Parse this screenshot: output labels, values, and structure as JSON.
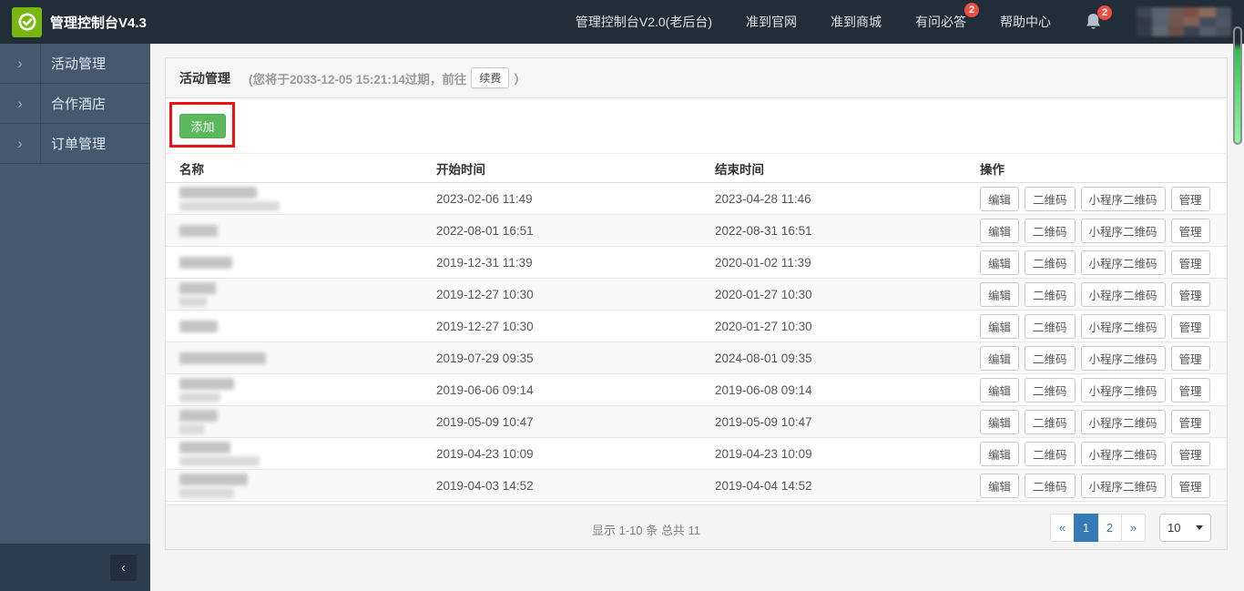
{
  "topbar": {
    "app_title": "管理控制台V4.3",
    "nav": [
      {
        "label": "管理控制台V2.0(老后台)",
        "badge": ""
      },
      {
        "label": "准到官网",
        "badge": ""
      },
      {
        "label": "准到商城",
        "badge": ""
      },
      {
        "label": "有问必答",
        "badge": "2"
      },
      {
        "label": "帮助中心",
        "badge": ""
      }
    ],
    "bell_badge": "2"
  },
  "sidebar": {
    "chevron_glyph": "›",
    "collapse_glyph": "‹",
    "items": [
      {
        "label": "活动管理"
      },
      {
        "label": "合作酒店"
      },
      {
        "label": "订单管理"
      }
    ]
  },
  "page": {
    "title": "活动管理",
    "expiry_before": "(您将于2033-12-05 15:21:14过期，前往",
    "renew_label": "续费",
    "expiry_after": "）"
  },
  "toolbar": {
    "add_label": "添加"
  },
  "table": {
    "columns": [
      "名称",
      "开始时间",
      "结束时间",
      "操作"
    ],
    "action_labels": [
      "编辑",
      "二维码",
      "小程序二维码",
      "管理"
    ],
    "rows": [
      {
        "name_redacted": true,
        "blur_w": 85,
        "blur_w2": 110,
        "start": "2023-02-06 11:49",
        "end": "2023-04-28 11:46"
      },
      {
        "name_redacted": true,
        "blur_w": 42,
        "blur_w2": 0,
        "start": "2022-08-01 16:51",
        "end": "2022-08-31 16:51"
      },
      {
        "name_redacted": true,
        "blur_w": 58,
        "blur_w2": 0,
        "start": "2019-12-31 11:39",
        "end": "2020-01-02 11:39"
      },
      {
        "name_redacted": true,
        "blur_w": 40,
        "blur_w2": 30,
        "start": "2019-12-27 10:30",
        "end": "2020-01-27 10:30"
      },
      {
        "name_redacted": true,
        "blur_w": 42,
        "blur_w2": 0,
        "start": "2019-12-27 10:30",
        "end": "2020-01-27 10:30"
      },
      {
        "name_redacted": true,
        "blur_w": 95,
        "blur_w2": 0,
        "start": "2019-07-29 09:35",
        "end": "2024-08-01 09:35"
      },
      {
        "name_redacted": true,
        "blur_w": 60,
        "blur_w2": 45,
        "start": "2019-06-06 09:14",
        "end": "2019-06-08 09:14"
      },
      {
        "name_redacted": true,
        "blur_w": 42,
        "blur_w2": 28,
        "start": "2019-05-09 10:47",
        "end": "2019-05-09 10:47"
      },
      {
        "name_redacted": true,
        "blur_w": 56,
        "blur_w2": 88,
        "start": "2019-04-23 10:09",
        "end": "2019-04-23 10:09"
      },
      {
        "name_redacted": true,
        "blur_w": 75,
        "blur_w2": 60,
        "start": "2019-04-03 14:52",
        "end": "2019-04-04 14:52"
      }
    ]
  },
  "pagination": {
    "info": "显示 1-10 条 总共 11",
    "prev": "«",
    "pages": [
      "1",
      "2"
    ],
    "active_page": "1",
    "next": "»",
    "page_size": "10"
  },
  "colors": {
    "topbar_bg": "#222d3a",
    "sidebar_bg": "#45586e",
    "brand_green": "#78b80e",
    "button_green": "#5cb85c",
    "active_blue": "#337ab7",
    "badge_red": "#ee4c44",
    "annotation_red": "#ee1111"
  }
}
